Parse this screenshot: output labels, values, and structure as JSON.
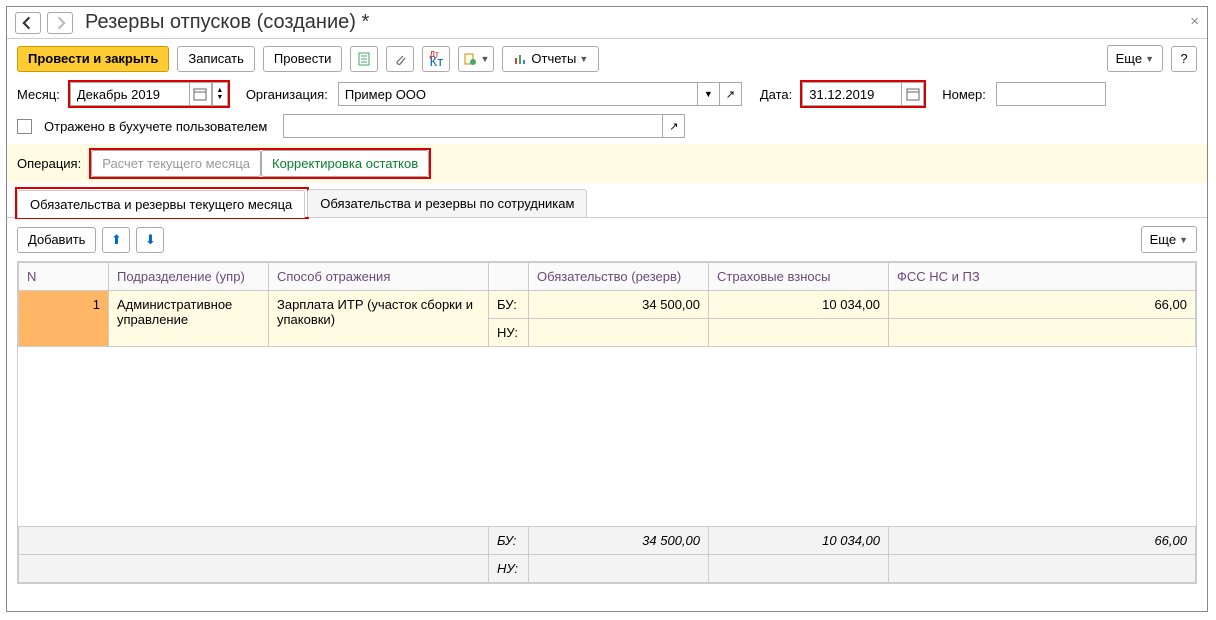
{
  "title": "Резервы отпусков (создание) *",
  "toolbar": {
    "post_and_close": "Провести и закрыть",
    "save": "Записать",
    "post": "Провести",
    "reports": "Отчеты",
    "more": "Еще",
    "help": "?"
  },
  "fields": {
    "month_label": "Месяц:",
    "month_value": "Декабрь 2019",
    "org_label": "Организация:",
    "org_value": "Пример ООО",
    "date_label": "Дата:",
    "date_value": "31.12.2019",
    "number_label": "Номер:",
    "number_value": "",
    "reflected_label": "Отражено в бухучете пользователем",
    "reflected_value": ""
  },
  "operation": {
    "label": "Операция:",
    "calc_current": "Расчет текущего месяца",
    "adjust": "Корректировка остатков"
  },
  "tabs": {
    "current": "Обязательства и резервы текущего месяца",
    "by_employee": "Обязательства и резервы по сотрудникам"
  },
  "grid": {
    "add": "Добавить",
    "more": "Еще",
    "columns": {
      "n": "N",
      "department": "Подразделение (упр)",
      "method": "Способ отражения",
      "reserve": "Обязательство (резерв)",
      "insurance": "Страховые взносы",
      "fss": "ФСС НС и ПЗ"
    },
    "bu_label": "БУ:",
    "nu_label": "НУ:",
    "rows": [
      {
        "n": "1",
        "department": "Административное управление",
        "method": "Зарплата ИТР (участок сборки и упаковки)",
        "bu_reserve": "34 500,00",
        "bu_insurance": "10 034,00",
        "bu_fss": "66,00",
        "nu_reserve": "",
        "nu_insurance": "",
        "nu_fss": ""
      }
    ],
    "footer": {
      "bu_reserve": "34 500,00",
      "bu_insurance": "10 034,00",
      "bu_fss": "66,00"
    }
  }
}
